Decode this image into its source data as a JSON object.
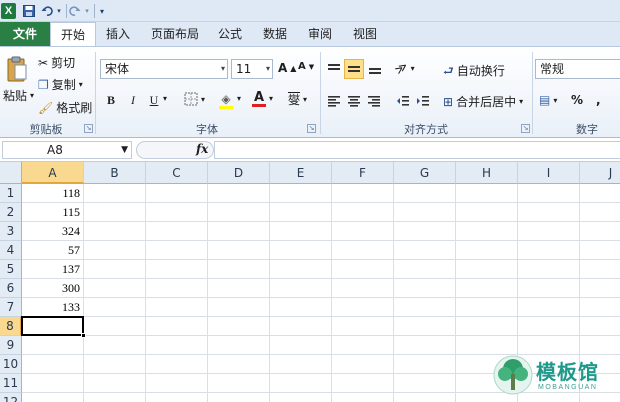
{
  "colors": {
    "file_tab": "#2a7f45",
    "selection": "#f9d88f",
    "header_bg": "#e3ebf5",
    "ribbon_text": "#1e1e1e",
    "watermark": "#1f9a8a"
  },
  "qat": {
    "app_icon": "excel-logo-icon",
    "logo_letter": "X",
    "save_icon": "save-icon",
    "undo_icon": "undo-icon",
    "redo_icon": "redo-icon",
    "customize_icon": "customize-qat-icon"
  },
  "tabs": [
    {
      "label": "文件"
    },
    {
      "label": "开始"
    },
    {
      "label": "插入"
    },
    {
      "label": "页面布局"
    },
    {
      "label": "公式"
    },
    {
      "label": "数据"
    },
    {
      "label": "审阅"
    },
    {
      "label": "视图"
    }
  ],
  "ribbon": {
    "clipboard": {
      "paste": "粘贴",
      "cut": "剪切",
      "copy": "复制",
      "format_painter": "格式刷",
      "group_label": "剪贴板"
    },
    "font": {
      "name": "宋体",
      "size": "11",
      "grow": "A",
      "shrink": "A",
      "bold": "B",
      "italic": "I",
      "underline": "U",
      "font_color_letter": "A",
      "phonetic": "燮",
      "group_label": "字体"
    },
    "alignment": {
      "wrap_text": "自动换行",
      "merge_center": "合并后居中",
      "group_label": "对齐方式"
    },
    "number": {
      "format": "常规",
      "percent": "%",
      "comma": ",",
      "group_label": "数字"
    }
  },
  "formula_bar": {
    "name_box": "A8",
    "fx": "fx",
    "formula": ""
  },
  "grid": {
    "columns": [
      "A",
      "B",
      "C",
      "D",
      "E",
      "F",
      "G",
      "H",
      "I",
      "J"
    ],
    "rows": [
      "1",
      "2",
      "3",
      "4",
      "5",
      "6",
      "7",
      "8",
      "9",
      "10",
      "11",
      "12"
    ],
    "column_a_values": [
      "118",
      "115",
      "324",
      "57",
      "137",
      "300",
      "133"
    ],
    "selected_cell": "A8"
  },
  "watermark": {
    "text": "模板馆",
    "sub": "MOBANGUAN"
  }
}
